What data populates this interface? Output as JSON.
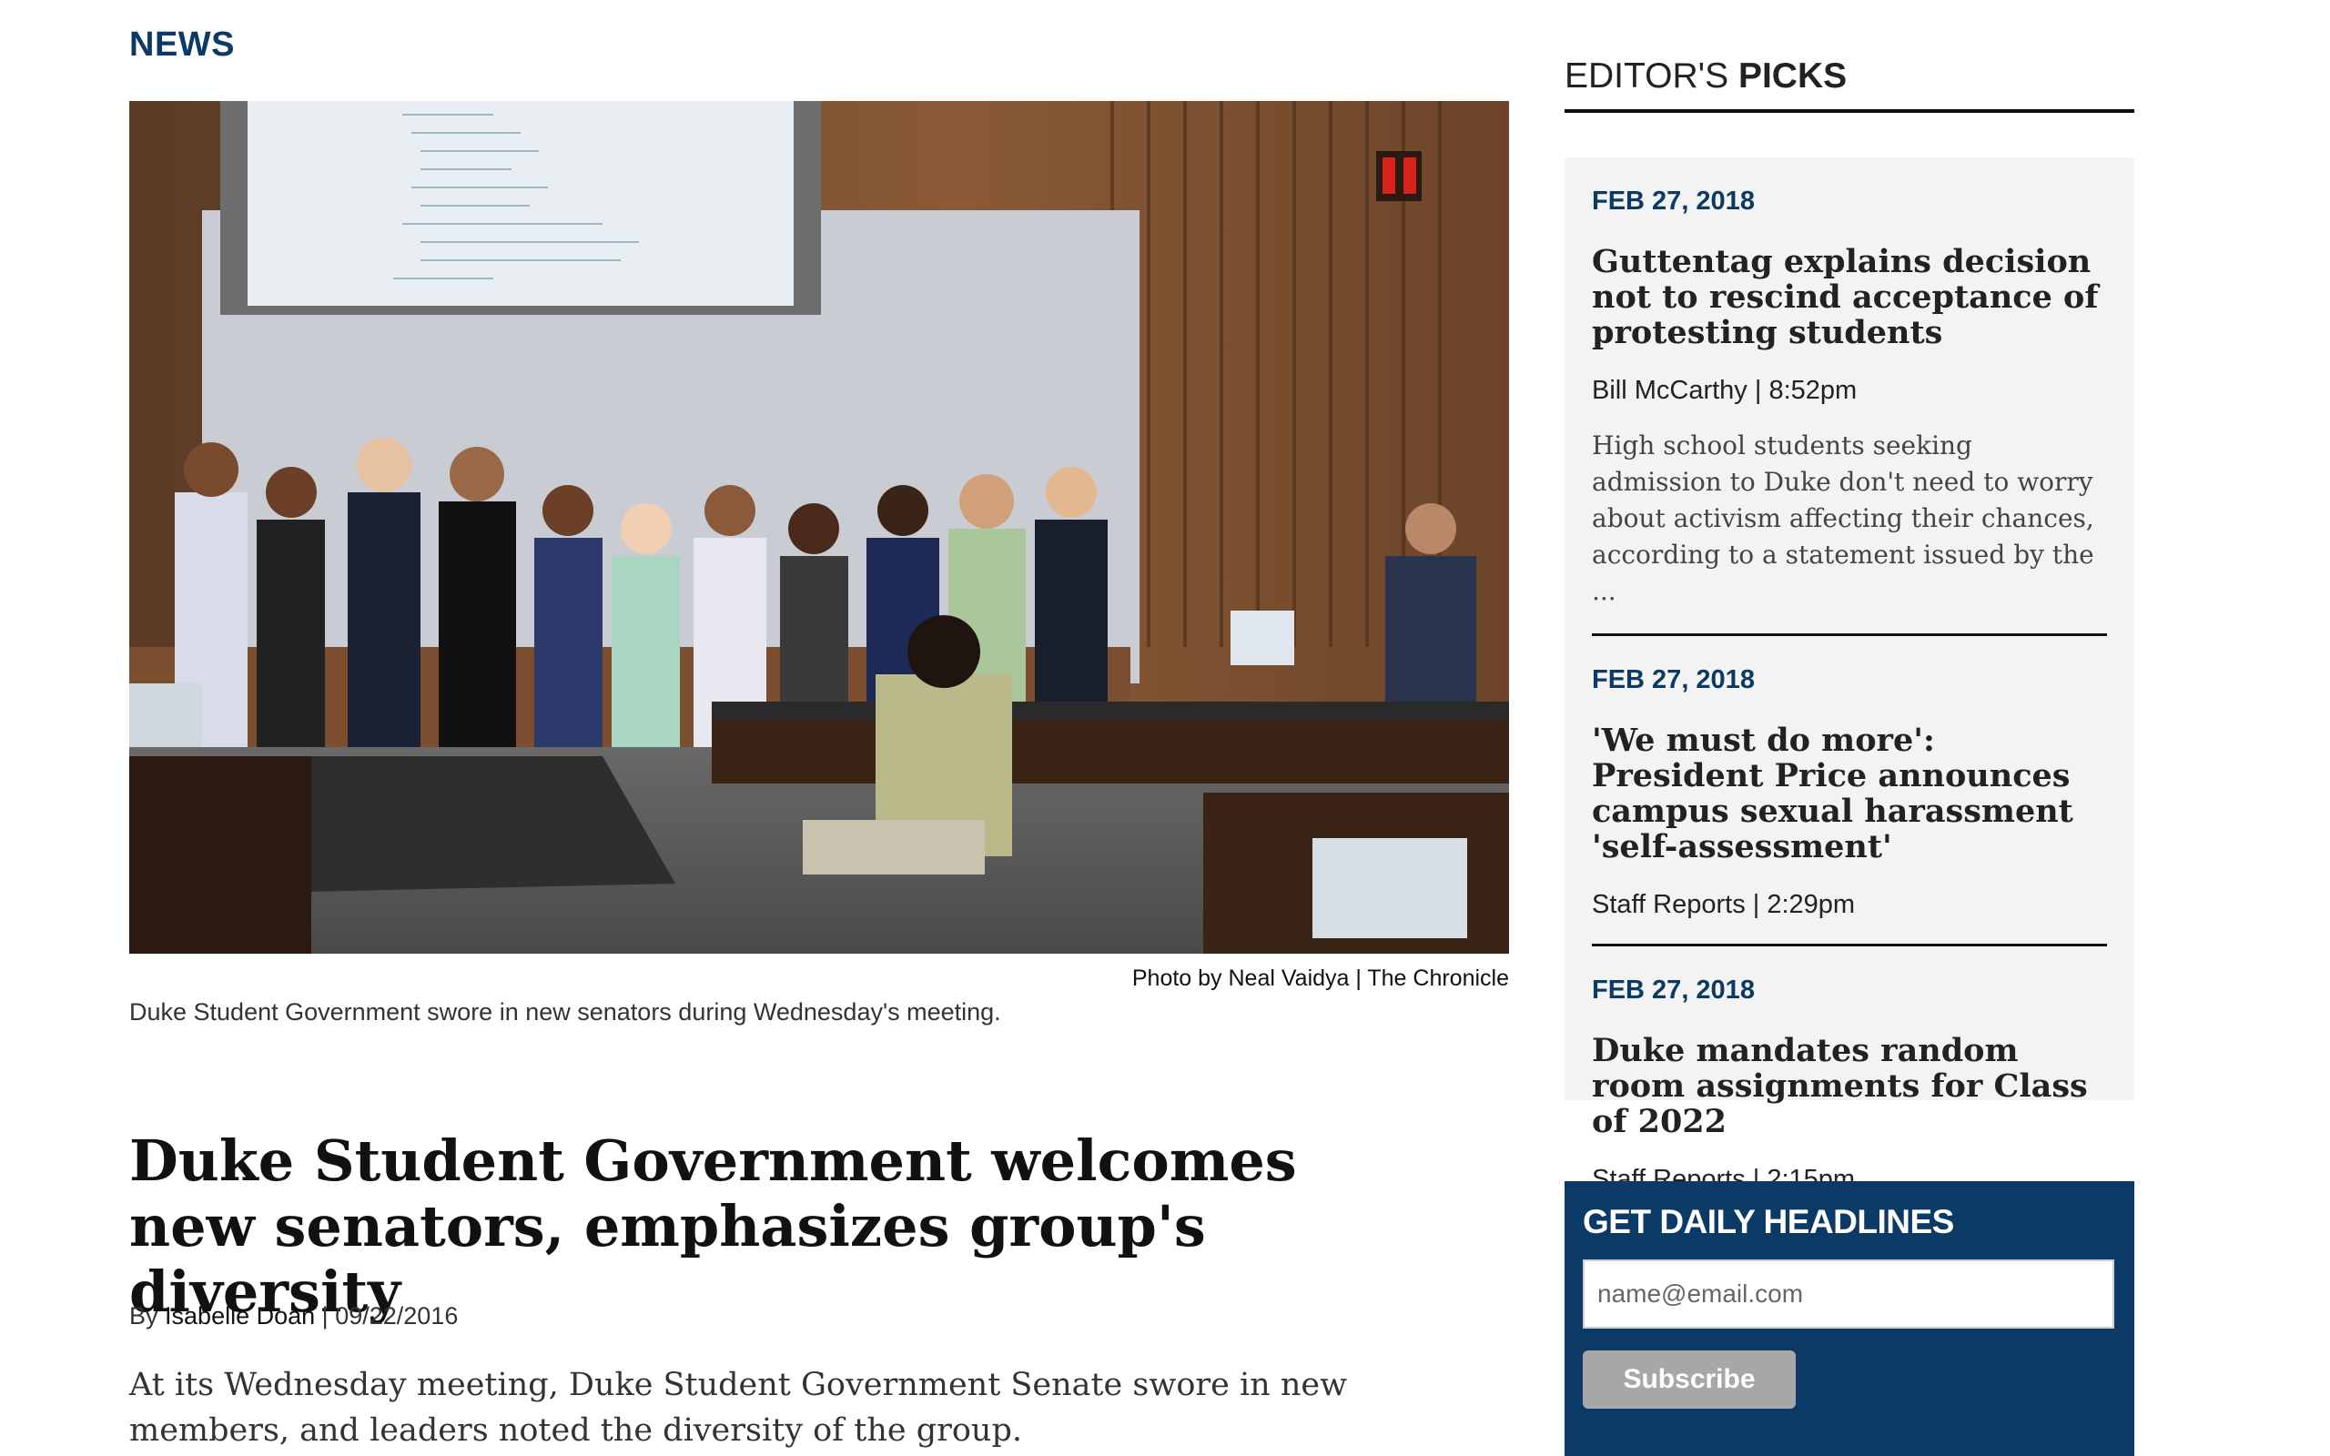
{
  "section": {
    "label": "NEWS"
  },
  "article": {
    "photo_credit": "Photo by Neal Vaidya | The Chronicle",
    "photo_caption": "Duke Student Government swore in new senators during Wednesday's meeting.",
    "headline": "Duke Student Government welcomes new senators, emphasizes group's diversity",
    "byline_prefix": "By",
    "author": "Isabelle Doan",
    "byline_sep": "|",
    "date": "09/22/2016",
    "lede": "At its Wednesday meeting, Duke Student Government Senate swore in new members, and leaders noted the diversity of the group."
  },
  "editors_picks": {
    "header_light": "EDITOR'S",
    "header_bold": "PICKS",
    "items": [
      {
        "date": "FEB 27, 2018",
        "title": "Guttentag explains decision not to rescind acceptance of protesting students",
        "meta": "Bill McCarthy | 8:52pm",
        "excerpt": "High school students seeking admission to Duke don't need to worry about activism affecting their chances, according to a statement issued by the ..."
      },
      {
        "date": "FEB 27, 2018",
        "title": "'We must do more': President Price announces campus sexual harassment 'self-assessment'",
        "meta": "Staff Reports | 2:29pm",
        "excerpt": ""
      },
      {
        "date": "FEB 27, 2018",
        "title": "Duke mandates random room assignments for Class of 2022",
        "meta": "Staff Reports | 2:15pm",
        "excerpt": ""
      }
    ]
  },
  "newsletter": {
    "title": "GET DAILY HEADLINES",
    "email_placeholder": "name@email.com",
    "email_value": "",
    "subscribe_label": "Subscribe"
  },
  "colors": {
    "brand_navy": "#0b3a66",
    "picks_bg": "#f3f3f3",
    "button_gray": "#a7a7a7"
  }
}
